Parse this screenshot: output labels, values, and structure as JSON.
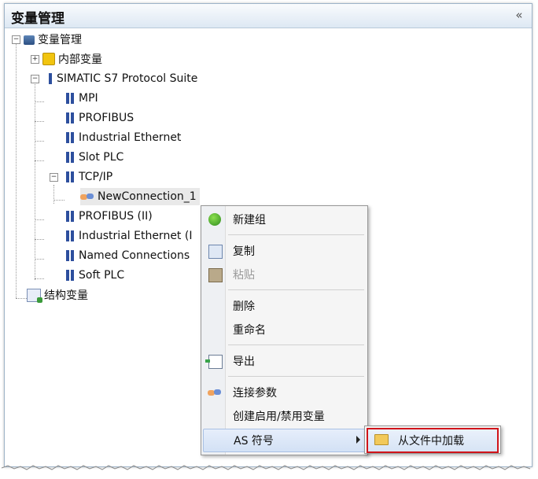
{
  "panel": {
    "title": "变量管理",
    "collapse_glyph": "«"
  },
  "tree": {
    "root": "变量管理",
    "internal_tags": "内部变量",
    "suite": "SIMATIC S7 Protocol Suite",
    "children": [
      "MPI",
      "PROFIBUS",
      "Industrial Ethernet",
      "Slot PLC",
      "TCP/IP"
    ],
    "connection": "NewConnection_1",
    "children2": [
      "PROFIBUS (II)",
      "Industrial Ethernet (I",
      "Named Connections",
      "Soft PLC"
    ],
    "struct_tags": "结构变量",
    "icons": {
      "root": "network-icon",
      "internal": "cube-icon",
      "suite": "driver-icon",
      "channel": "channel-icon",
      "connection": "handshake-icon",
      "struct": "struct-tags-icon"
    }
  },
  "context_menu": {
    "new_group": "新建组",
    "copy": "复制",
    "paste": "粘贴",
    "delete": "删除",
    "rename": "重命名",
    "export": "导出",
    "connection_params": "连接参数",
    "create_enable_tag": "创建启用/禁用变量",
    "as_symbols": "AS 符号"
  },
  "submenu": {
    "load_from_file": "从文件中加载"
  },
  "colors": {
    "highlight_border": "#d0141a",
    "title_gradient_end": "#dde8f3"
  }
}
